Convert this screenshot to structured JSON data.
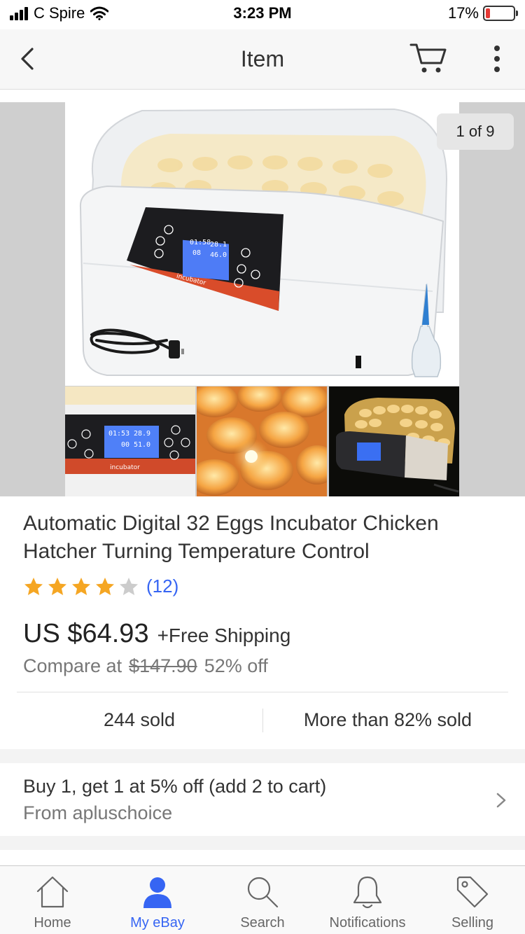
{
  "status_bar": {
    "carrier": "C Spire",
    "time": "3:23 PM",
    "battery": "17%",
    "battery_level": 0.17
  },
  "nav": {
    "title": "Item",
    "icons": [
      "back-chevron-icon",
      "cart-icon",
      "more-vertical-icon"
    ]
  },
  "gallery": {
    "counter": "1 of 9",
    "main_display": {
      "time": "01:58",
      "temp": "28.1",
      "day": "08",
      "humidity": "46.0",
      "brand": "incubator"
    },
    "thumb1_display": {
      "time": "01:53",
      "temp": "28.9",
      "day": "00",
      "humidity": "51.0",
      "brand": "incubator"
    }
  },
  "product": {
    "title": "Automatic Digital 32 Eggs Incubator Chicken Hatcher Turning Temperature Control",
    "rating": 4,
    "rating_max": 5,
    "rating_count": "(12)",
    "price": "US $64.93",
    "shipping": "+Free Shipping",
    "compare_label": "Compare at",
    "compare_price": "$147.90",
    "discount": "52% off",
    "sold": "244 sold",
    "sold_percent": "More than 82% sold"
  },
  "promo": {
    "line1": "Buy 1, get 1 at 5% off (add 2 to cart)",
    "line2": "From apluschoice"
  },
  "tabs": [
    {
      "label": "Home",
      "icon": "home-icon",
      "active": false
    },
    {
      "label": "My eBay",
      "icon": "person-icon",
      "active": true
    },
    {
      "label": "Search",
      "icon": "search-icon",
      "active": false
    },
    {
      "label": "Notifications",
      "icon": "bell-icon",
      "active": false
    },
    {
      "label": "Selling",
      "icon": "tag-icon",
      "active": false
    }
  ],
  "colors": {
    "accent": "#3665f3",
    "star": "#f5a623",
    "star_empty": "#cccccc",
    "battery_low": "#e53935"
  }
}
